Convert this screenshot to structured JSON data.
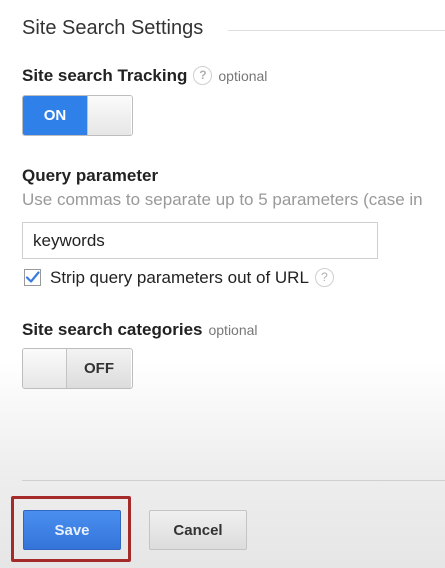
{
  "section": {
    "title": "Site Search Settings"
  },
  "site_search_tracking": {
    "label": "Site search Tracking",
    "help_icon": "question-circle-icon",
    "help_text": "?",
    "optional": "optional",
    "toggle_state": "ON"
  },
  "query_parameter": {
    "label": "Query parameter",
    "hint": "Use commas to separate up to 5 parameters (case in",
    "value": "keywords",
    "strip_checkbox": {
      "checked": true,
      "label": "Strip query parameters out of URL",
      "help_text": "?"
    }
  },
  "site_search_categories": {
    "label": "Site search categories",
    "optional": "optional",
    "toggle_state": "OFF"
  },
  "actions": {
    "save_label": "Save",
    "cancel_label": "Cancel"
  },
  "colors": {
    "toggle_on": "#2f80e8",
    "save_button": "#3b7fe3",
    "highlight_border": "#a52a2a"
  }
}
